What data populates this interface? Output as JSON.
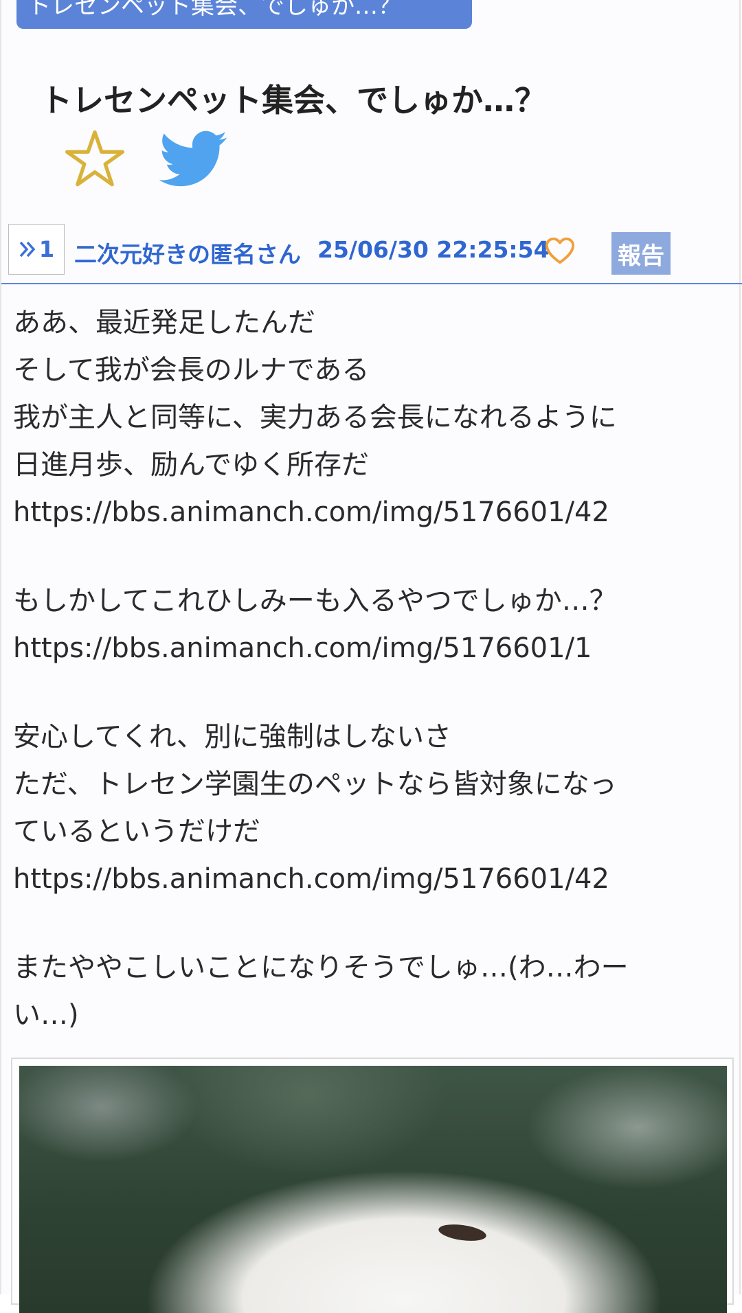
{
  "thread": {
    "pill_title": "トレセンペット集会、でしゅか…？",
    "title": "トレセンペット集会、でしゅか…？"
  },
  "icons": {
    "favorite": "star-outline-icon",
    "share": "twitter-bird-icon",
    "like": "heart-outline-icon",
    "anchor": "double-chevron-right-icon"
  },
  "post": {
    "number": "1",
    "author": "二次元好きの匿名さん",
    "date": "25/06/30 22:25:54",
    "report_label": "報告",
    "lines": [
      "ああ、最近発足したんだ",
      "そして我が会長のルナである",
      "我が主人と同等に、実力ある会長になれるように",
      "日進月歩、励んでゆく所存だ",
      "https://bbs.animanch.com/img/5176601/42",
      "",
      "もしかしてこれひしみーも入るやつでしゅか…？",
      "https://bbs.animanch.com/img/5176601/1",
      "",
      "安心してくれ、別に強制はしないさ",
      "ただ、トレセン学園生のペットなら皆対象になっ",
      "ているというだけだ",
      "https://bbs.animanch.com/img/5176601/42",
      "",
      "またややこしいことになりそうでしゅ…(わ…わー",
      "い…)"
    ]
  },
  "colors": {
    "accent": "#5b84d9",
    "link_blue": "#2f66d0",
    "star_gold": "#d9b23a",
    "twitter_blue": "#4fa3ef",
    "heart_orange": "#f0a03a",
    "report_bg": "#8ea9dd"
  }
}
